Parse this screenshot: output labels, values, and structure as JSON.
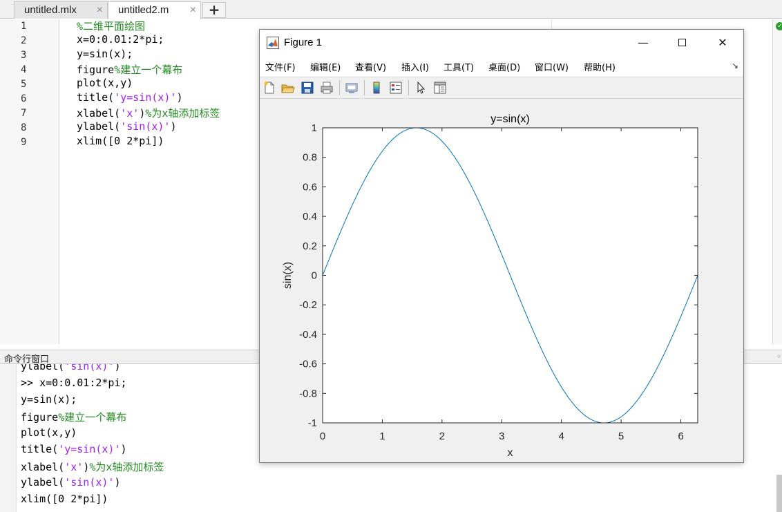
{
  "editor": {
    "tabs": [
      {
        "label": "untitled.mlx",
        "close": "×"
      },
      {
        "label": "untitled2.m",
        "close": "×"
      }
    ],
    "add_tab": "+",
    "line_numbers": [
      "1",
      "2",
      "3",
      "4",
      "5",
      "6",
      "7",
      "8",
      "9"
    ],
    "lines": [
      {
        "parts": [
          {
            "t": "%二维平面绘图",
            "c": "cm"
          }
        ]
      },
      {
        "parts": [
          {
            "t": "x=0:0.01:2*pi;",
            "c": ""
          }
        ]
      },
      {
        "parts": [
          {
            "t": "y=sin(x);",
            "c": ""
          }
        ]
      },
      {
        "parts": [
          {
            "t": "figure",
            "c": ""
          },
          {
            "t": "%建立一个幕布",
            "c": "cm"
          }
        ]
      },
      {
        "parts": [
          {
            "t": "plot(x,y)",
            "c": ""
          }
        ]
      },
      {
        "parts": [
          {
            "t": "title(",
            "c": ""
          },
          {
            "t": "'y=sin(x)'",
            "c": "str"
          },
          {
            "t": ")",
            "c": ""
          }
        ]
      },
      {
        "parts": [
          {
            "t": "xlabel(",
            "c": ""
          },
          {
            "t": "'x'",
            "c": "str"
          },
          {
            "t": ")",
            "c": ""
          },
          {
            "t": "%为x轴添加标签",
            "c": "cm"
          }
        ]
      },
      {
        "parts": [
          {
            "t": "ylabel(",
            "c": ""
          },
          {
            "t": "'sin(x)'",
            "c": "str"
          },
          {
            "t": ")",
            "c": ""
          }
        ]
      },
      {
        "parts": [
          {
            "t": "xlim([0 2*pi])",
            "c": ""
          }
        ]
      }
    ]
  },
  "command_window": {
    "title": "命令行窗口",
    "lines": [
      {
        "parts": [
          {
            "t": "ylabel(",
            "c": ""
          },
          {
            "t": "'sin(x)'",
            "c": "str"
          },
          {
            "t": ")",
            "c": ""
          }
        ]
      },
      {
        "parts": [
          {
            "t": ">> x=0:0.01:2*pi;",
            "c": ""
          }
        ]
      },
      {
        "parts": [
          {
            "t": "y=sin(x);",
            "c": ""
          }
        ]
      },
      {
        "parts": [
          {
            "t": "figure",
            "c": ""
          },
          {
            "t": "%建立一个幕布",
            "c": "cm"
          }
        ]
      },
      {
        "parts": [
          {
            "t": "plot(x,y)",
            "c": ""
          }
        ]
      },
      {
        "parts": [
          {
            "t": "title(",
            "c": ""
          },
          {
            "t": "'y=sin(x)'",
            "c": "str"
          },
          {
            "t": ")",
            "c": ""
          }
        ]
      },
      {
        "parts": [
          {
            "t": "xlabel(",
            "c": ""
          },
          {
            "t": "'x'",
            "c": "str"
          },
          {
            "t": ")",
            "c": ""
          },
          {
            "t": "%为x轴添加标签",
            "c": "cm"
          }
        ]
      },
      {
        "parts": [
          {
            "t": "ylabel(",
            "c": ""
          },
          {
            "t": "'sin(x)'",
            "c": "str"
          },
          {
            "t": ")",
            "c": ""
          }
        ]
      },
      {
        "parts": [
          {
            "t": "xlim([0 2*pi])",
            "c": ""
          }
        ]
      }
    ]
  },
  "figure": {
    "title": "Figure 1",
    "window_buttons": {
      "minimize": "—",
      "close": "✕"
    },
    "menus": [
      "文件(F)",
      "编辑(E)",
      "查看(V)",
      "插入(I)",
      "工具(T)",
      "桌面(D)",
      "窗口(W)",
      "帮助(H)"
    ],
    "dock_arrow": "↘",
    "toolbar_icons": [
      "new-figure-icon",
      "open-file-icon",
      "save-icon",
      "print-icon",
      "link-plot-icon",
      "insert-colorbar-icon",
      "insert-legend-icon",
      "edit-plot-pointer-icon",
      "property-editor-icon"
    ]
  },
  "colors": {
    "comment": "#228b22",
    "string": "#a020f0",
    "line": "#0072bd"
  },
  "chart_data": {
    "type": "line",
    "title": "y=sin(x)",
    "xlabel": "x",
    "ylabel": "sin(x)",
    "xlim": [
      0,
      6.2832
    ],
    "ylim": [
      -1,
      1
    ],
    "xticks": [
      0,
      1,
      2,
      3,
      4,
      5,
      6
    ],
    "yticks": [
      -1,
      -0.8,
      -0.6,
      -0.4,
      -0.2,
      0,
      0.2,
      0.4,
      0.6,
      0.8,
      1
    ],
    "ytick_labels": [
      "-1",
      "-0.8",
      "-0.6",
      "-0.4",
      "-0.2",
      "0",
      "0.2",
      "0.4",
      "0.6",
      "0.8",
      "1"
    ],
    "grid": false,
    "series": [
      {
        "function": "sin(x)",
        "x_start": 0,
        "x_step": 0.01,
        "x_end": 6.28,
        "color": "#0072bd"
      }
    ]
  }
}
